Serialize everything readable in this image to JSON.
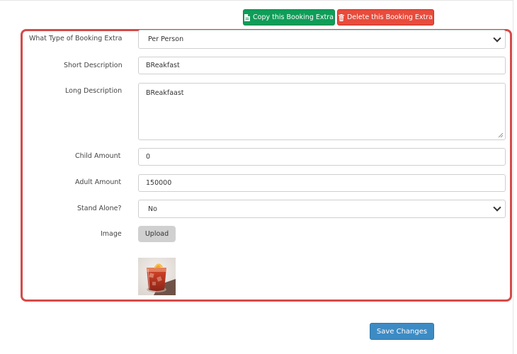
{
  "toolbar": {
    "copy_label": "Copy this Booking Extra",
    "delete_label": "Delete this Booking Extra"
  },
  "form": {
    "type": {
      "label": "What Type of Booking Extra",
      "value": "Per Person"
    },
    "short_description": {
      "label": "Short Description",
      "value": "BReakfast"
    },
    "long_description": {
      "label": "Long Description",
      "value": "BReakfaast"
    },
    "child_amount": {
      "label": "Child Amount",
      "value": "0"
    },
    "adult_amount": {
      "label": "Adult Amount",
      "value": "150000"
    },
    "stand_alone": {
      "label": "Stand Alone?",
      "value": "No"
    },
    "image": {
      "label": "Image",
      "upload_label": "Upload"
    }
  },
  "footer": {
    "save_label": "Save Changes"
  },
  "colors": {
    "copy_button": "#0f9d58",
    "delete_button": "#e74c3c",
    "save_button": "#3d8bc4",
    "highlight_border": "#d54a4a"
  }
}
